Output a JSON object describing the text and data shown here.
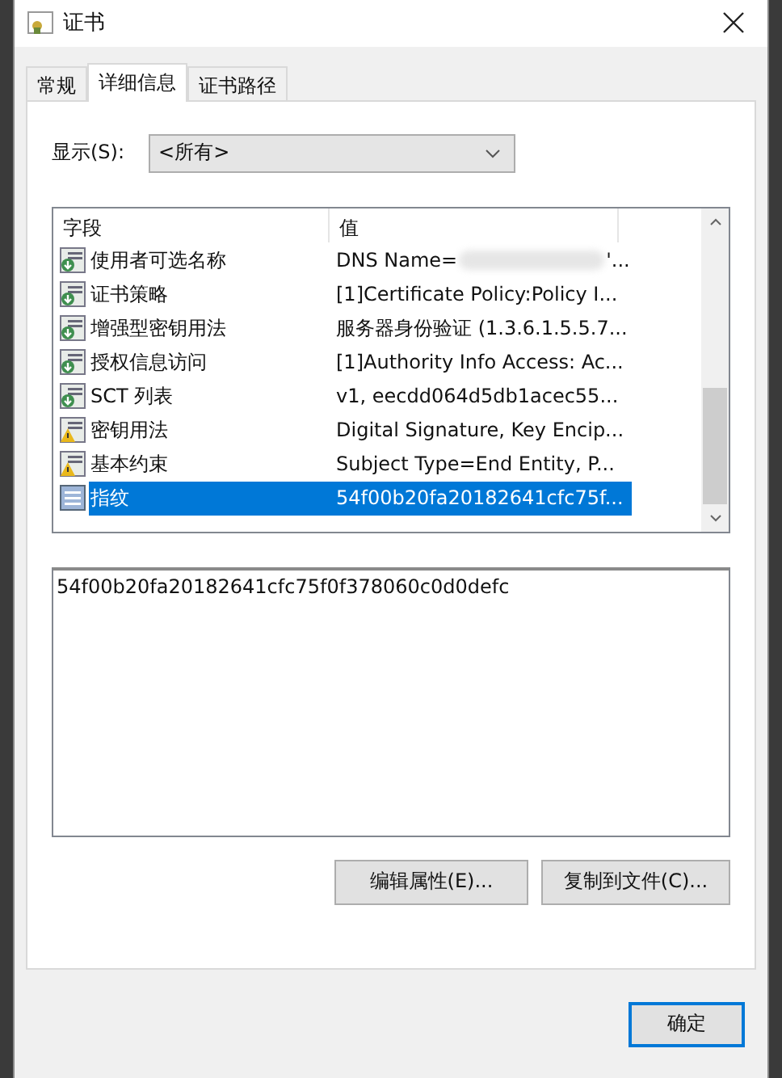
{
  "window": {
    "title": "证书"
  },
  "tabs": [
    {
      "label": "常规",
      "selected": false
    },
    {
      "label": "详细信息",
      "selected": true
    },
    {
      "label": "证书路径",
      "selected": false
    }
  ],
  "show": {
    "label": "显示(S):",
    "value": "<所有>"
  },
  "table": {
    "columns": [
      "字段",
      "值"
    ],
    "rows": [
      {
        "field": "使用者可选名称",
        "value": "DNS Name=",
        "redacted": true,
        "value_end": "'...",
        "kind": "extension",
        "selected": false
      },
      {
        "field": "证书策略",
        "value": "[1]Certificate Policy:Policy I...",
        "kind": "extension",
        "selected": false
      },
      {
        "field": "增强型密钥用法",
        "value": "服务器身份验证 (1.3.6.1.5.5.7...",
        "kind": "extension",
        "selected": false
      },
      {
        "field": "授权信息访问",
        "value": "[1]Authority Info Access: Ac...",
        "kind": "extension",
        "selected": false
      },
      {
        "field": "SCT 列表",
        "value": "v1, eecdd064d5db1acec55...",
        "kind": "extension",
        "selected": false
      },
      {
        "field": "密钥用法",
        "value": "Digital Signature, Key Encip...",
        "kind": "critical",
        "selected": false
      },
      {
        "field": "基本约束",
        "value": "Subject Type=End Entity, P...",
        "kind": "critical",
        "selected": false
      },
      {
        "field": "指纹",
        "value": "54f00b20fa20182641cfc75f...",
        "kind": "property",
        "selected": true
      }
    ]
  },
  "detail": {
    "value": "54f00b20fa20182641cfc75f0f378060c0d0defc"
  },
  "buttons": [
    "编辑属性(E)...",
    "复制到文件(C)..."
  ],
  "ok_button": "确定"
}
